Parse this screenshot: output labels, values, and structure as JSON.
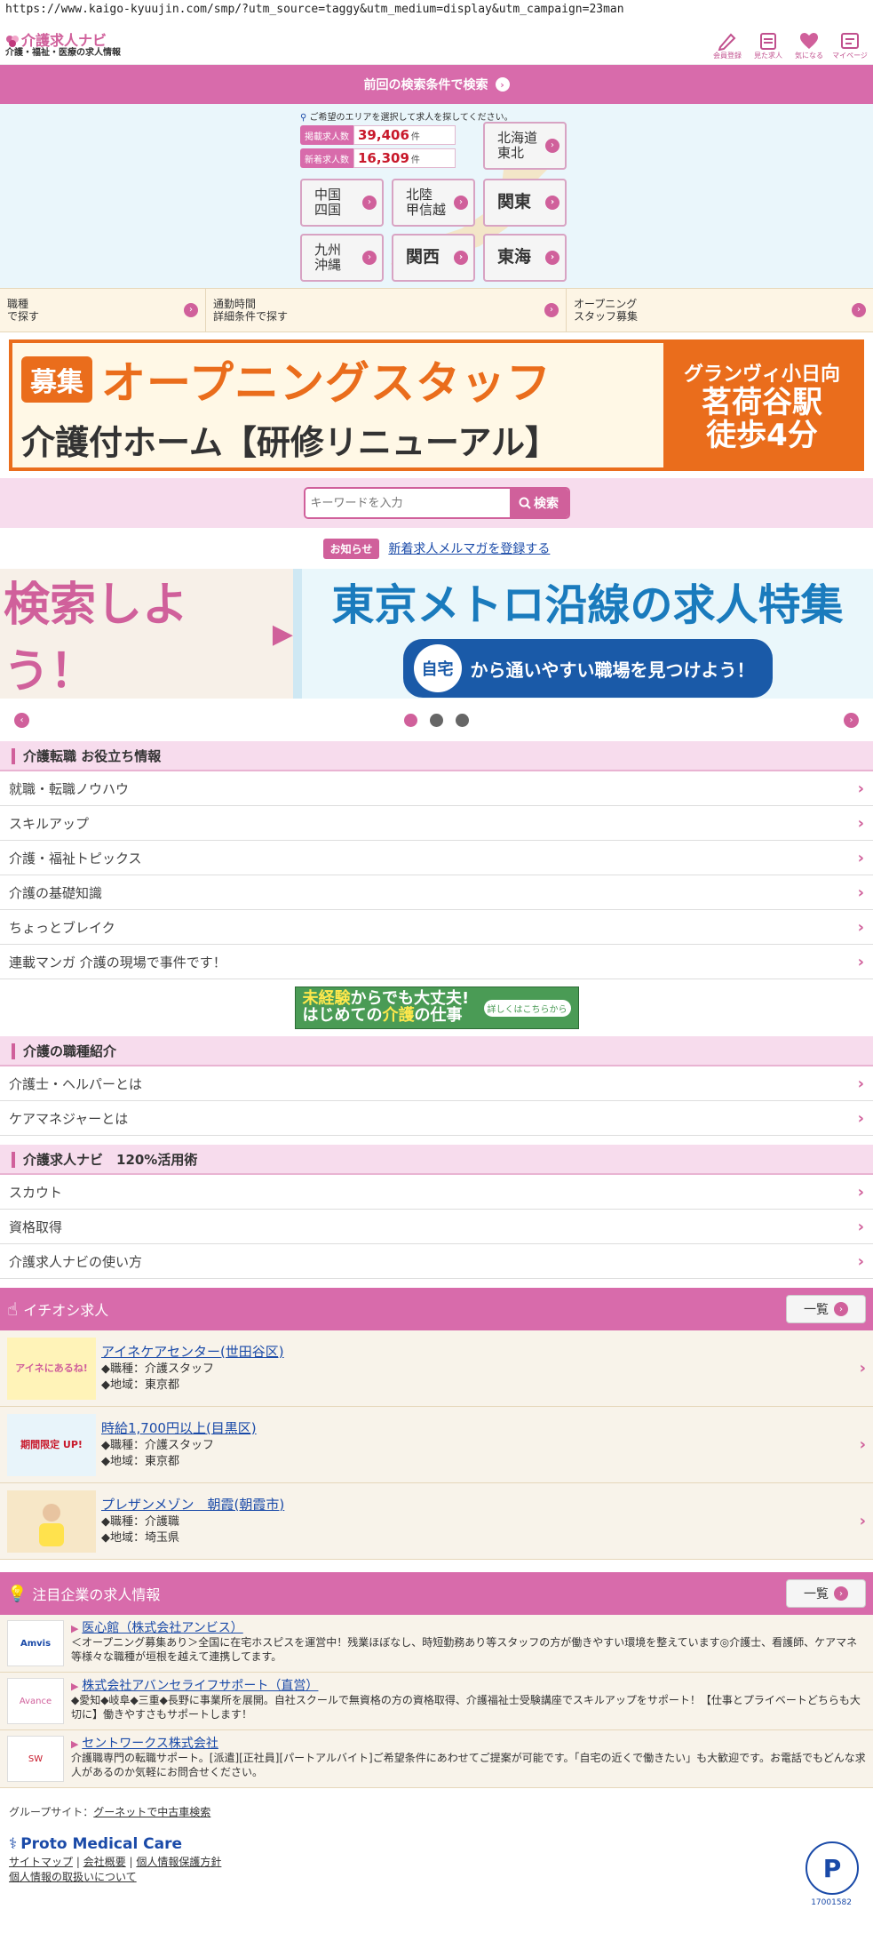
{
  "url": "https://www.kaigo-kyuujin.com/smp/?utm_source=taggy&utm_medium=display&utm_campaign=23man",
  "header": {
    "logo_main": "介護求人ナビ",
    "logo_sub": "介護・福祉・医療の求人情報",
    "icons": [
      {
        "label": "会員登録",
        "icon": "pencil-icon"
      },
      {
        "label": "見た求人",
        "icon": "calendar-icon"
      },
      {
        "label": "気になる",
        "icon": "heart-icon"
      },
      {
        "label": "マイページ",
        "icon": "mypage-icon"
      }
    ]
  },
  "prev_search": "前回の検索条件で検索",
  "area": {
    "note": "ご希望のエリアを選択して求人を探してください。",
    "total_label": "掲載求人数",
    "total_value": "39,406",
    "new_label": "新着求人数",
    "new_value": "16,309",
    "unit": "件",
    "regions": {
      "hokkaido": "北海道\n東北",
      "chugoku": "中国\n四国",
      "hokuriku": "北陸\n甲信越",
      "kanto": "関東",
      "kyushu": "九州\n沖縄",
      "kansai": "関西",
      "tokai": "東海"
    }
  },
  "search_row": [
    "職種\nで探す",
    "通勤時間\n詳細条件で探す",
    "オープニング\nスタッフ募集"
  ],
  "top_banner": {
    "tag": "募集",
    "line1": "オープニングスタッフ",
    "line2": "介護付ホーム【研修リニューアル】",
    "right1": "グランヴィ小日向",
    "right2": "茗荷谷駅",
    "right3": "徒歩4分"
  },
  "search": {
    "placeholder": "キーワードを入力",
    "button": "検索"
  },
  "notice": {
    "badge": "お知らせ",
    "link": "新着求人メルマガを登録する"
  },
  "carousel": {
    "left_text": "検索しよう！",
    "title": "東京メトロ沿線の求人特集",
    "badge": "自宅",
    "sub": "から通いやすい職場を見つけよう！"
  },
  "sections": {
    "tips": {
      "title": "介護転職 お役立ち情報",
      "items": [
        "就職・転職ノウハウ",
        "スキルアップ",
        "介護・福祉トピックス",
        "介護の基礎知識",
        "ちょっとブレイク",
        "連載マンガ 介護の現場で事件です！"
      ]
    },
    "mid_banner": {
      "line1a": "未経験",
      "line1b": "からでも大丈夫!",
      "line2a": "はじめての",
      "line2b": "介護",
      "line2c": "の仕事",
      "badge": "詳しくはこちらから"
    },
    "jobs_intro": {
      "title": "介護の職種紹介",
      "items": [
        "介護士・ヘルパーとは",
        "ケアマネジャーとは"
      ]
    },
    "navi": {
      "title": "介護求人ナビ　120%活用術",
      "items": [
        "スカウト",
        "資格取得",
        "介護求人ナビの使い方"
      ]
    }
  },
  "featured": {
    "title": "イチオシ求人",
    "more": "一覧",
    "jobs": [
      {
        "name": "アイネケアセンター(世田谷区)",
        "job": "◆職種：介護スタッフ",
        "area": "◆地域：東京都",
        "thumb": "アイネにあるね!"
      },
      {
        "name": "時給1,700円以上(目黒区)",
        "job": "◆職種：介護スタッフ",
        "area": "◆地域：東京都",
        "thumb": "期間限定 UP!"
      },
      {
        "name": "プレザンメゾン　朝霞(朝霞市)",
        "job": "◆職種：介護職",
        "area": "◆地域：埼玉県",
        "thumb": ""
      }
    ]
  },
  "companies": {
    "title": "注目企業の求人情報",
    "more": "一覧",
    "list": [
      {
        "name": "医心館（株式会社アンビス）",
        "desc": "＜オープニング募集あり＞全国に在宅ホスピスを運営中！残業ほぼなし、時短勤務あり等スタッフの方が働きやすい環境を整えています◎介護士、看護師、ケアマネ等様々な職種が垣根を越えて連携してます。",
        "logo": "Amvis"
      },
      {
        "name": "株式会社アバンセライフサポート（直営）",
        "desc": "◆愛知◆岐阜◆三重◆長野に事業所を展開。自社スクールで無資格の方の資格取得、介護福祉士受験講座でスキルアップをサポート！【仕事とプライベートどちらも大切に】働きやすさもサポートします！",
        "logo": "Avance"
      },
      {
        "name": "セントワークス株式会社",
        "desc": "介護職専門の転職サポート。[派遣][正社員][パートアルバイト]ご希望条件にあわせてご提案が可能です。「自宅の近くで働きたい」も大歓迎です。お電話でもどんな求人があるのか気軽にお問合せください。",
        "logo": "SW"
      }
    ]
  },
  "footer": {
    "group_label": "グループサイト：",
    "group_link": "グーネットで中古車検索",
    "brand": "Proto Medical Care",
    "links": [
      "サイトマップ",
      "会社概要",
      "個人情報保護方針"
    ],
    "privacy": "個人情報の取扱いについて",
    "pmark_num": "17001582"
  },
  "colors": {
    "brand_pink": "#d86bab",
    "orange": "#ea6d1c",
    "link_blue": "#1a4aa8"
  }
}
